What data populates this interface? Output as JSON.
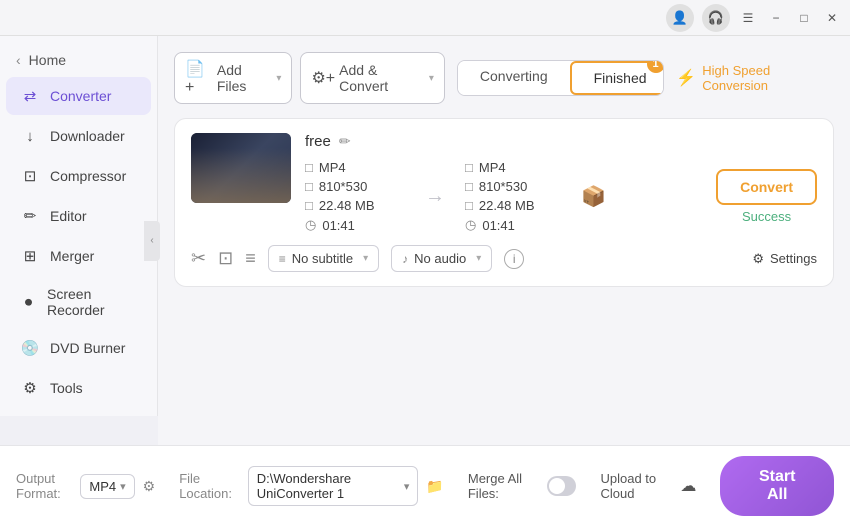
{
  "titlebar": {
    "profile_icon": "👤",
    "help_icon": "🎧",
    "menu_icon": "☰",
    "min_icon": "−",
    "max_icon": "□",
    "close_icon": "✕"
  },
  "sidebar": {
    "home_label": "Home",
    "items": [
      {
        "id": "converter",
        "label": "Converter",
        "icon": "⇄",
        "active": true
      },
      {
        "id": "downloader",
        "label": "Downloader",
        "icon": "↓"
      },
      {
        "id": "compressor",
        "label": "Compressor",
        "icon": "⊡"
      },
      {
        "id": "editor",
        "label": "Editor",
        "icon": "✏"
      },
      {
        "id": "merger",
        "label": "Merger",
        "icon": "⊞"
      },
      {
        "id": "screen-recorder",
        "label": "Screen Recorder",
        "icon": "⏺"
      },
      {
        "id": "dvd-burner",
        "label": "DVD Burner",
        "icon": "💿"
      },
      {
        "id": "tools",
        "label": "Tools",
        "icon": "⚙"
      }
    ]
  },
  "topbar": {
    "add_files_label": "Add Files",
    "add_convert_label": "Add & Convert",
    "converting_tab": "Converting",
    "finished_tab": "Finished",
    "finished_badge": "1",
    "high_speed_label": "High Speed Conversion"
  },
  "file_item": {
    "name": "free",
    "src_format": "MP4",
    "src_resolution": "810*530",
    "src_size": "22.48 MB",
    "src_duration": "01:41",
    "dst_format": "MP4",
    "dst_resolution": "810*530",
    "dst_size": "22.48 MB",
    "dst_duration": "01:41",
    "convert_btn": "Convert",
    "success_text": "Success",
    "subtitle_label": "No subtitle",
    "audio_label": "No audio",
    "settings_label": "Settings"
  },
  "footer": {
    "output_format_label": "Output Format:",
    "output_format_value": "MP4",
    "file_location_label": "File Location:",
    "file_location_value": "D:\\Wondershare UniConverter 1",
    "merge_label": "Merge All Files:",
    "upload_label": "Upload to Cloud",
    "start_all_label": "Start All"
  }
}
